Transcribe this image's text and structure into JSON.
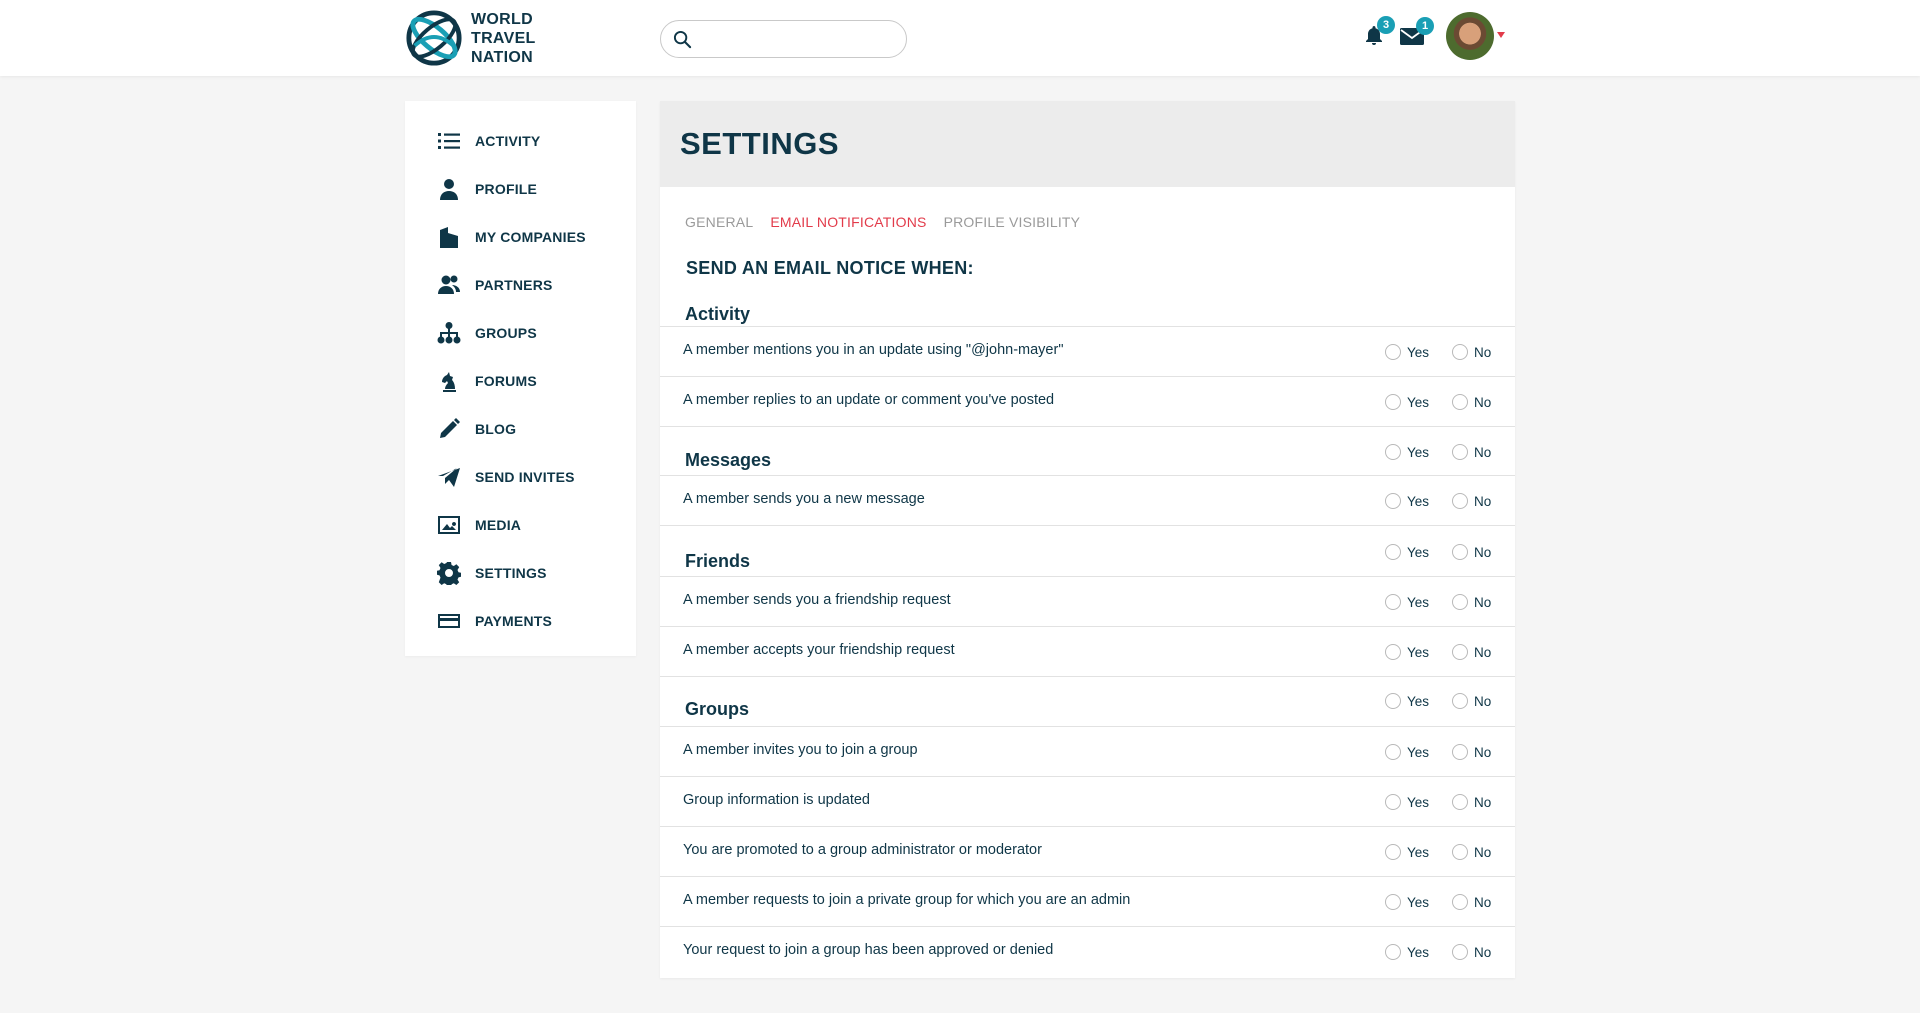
{
  "brand": {
    "name_line1": "WORLD",
    "name_line2": "TRAVEL",
    "name_line3": "NATION",
    "logo_icon": "globe-orbit-logo"
  },
  "header": {
    "search": {
      "placeholder": "",
      "value": "",
      "icon": "search-icon"
    },
    "notifications": {
      "icon": "bell-icon",
      "count": "3"
    },
    "messages": {
      "icon": "envelope-icon",
      "count": "1"
    },
    "avatar": {
      "icon": "user-avatar"
    }
  },
  "sidebar": {
    "items": [
      {
        "label": "ACTIVITY",
        "icon": "list-icon"
      },
      {
        "label": "PROFILE",
        "icon": "person-icon"
      },
      {
        "label": "MY COMPANIES",
        "icon": "building-icon"
      },
      {
        "label": "PARTNERS",
        "icon": "people-icon"
      },
      {
        "label": "GROUPS",
        "icon": "sitemap-icon"
      },
      {
        "label": "FORUMS",
        "icon": "chess-knight-icon"
      },
      {
        "label": "BLOG",
        "icon": "pencil-icon"
      },
      {
        "label": "SEND INVITES",
        "icon": "paper-plane-icon"
      },
      {
        "label": "MEDIA",
        "icon": "image-icon"
      },
      {
        "label": "SETTINGS",
        "icon": "gear-icon"
      },
      {
        "label": "PAYMENTS",
        "icon": "credit-card-icon"
      }
    ]
  },
  "main": {
    "title": "SETTINGS",
    "tabs": [
      {
        "label": "GENERAL",
        "active": false
      },
      {
        "label": "EMAIL NOTIFICATIONS",
        "active": true
      },
      {
        "label": "PROFILE VISIBILITY",
        "active": false
      }
    ],
    "section_title": "SEND AN EMAIL NOTICE WHEN:",
    "yes_label": "Yes",
    "no_label": "No",
    "groups": [
      {
        "title": "Activity"
      },
      {
        "title": "Messages"
      },
      {
        "title": "Friends"
      },
      {
        "title": "Groups"
      }
    ],
    "rows": [
      {
        "text": "A member mentions you in an update using \"@john-mayer\""
      },
      {
        "text": "A member replies to an update or comment you've posted"
      },
      {
        "text": "A member sends you a new message"
      },
      {
        "text": "A member sends you a friendship request"
      },
      {
        "text": "A member accepts your friendship request"
      },
      {
        "text": "A member invites you to join a group"
      },
      {
        "text": "Group information is updated"
      },
      {
        "text": "You are promoted to a group administrator or moderator"
      },
      {
        "text": "A member requests to join a private group for which you are an admin"
      },
      {
        "text": "Your request to join a group has been approved or denied"
      }
    ]
  },
  "colors": {
    "navy": "#0f3647",
    "accent_red": "#e23b4a",
    "teal": "#1a9fb5",
    "background": "#f5f5f5"
  }
}
